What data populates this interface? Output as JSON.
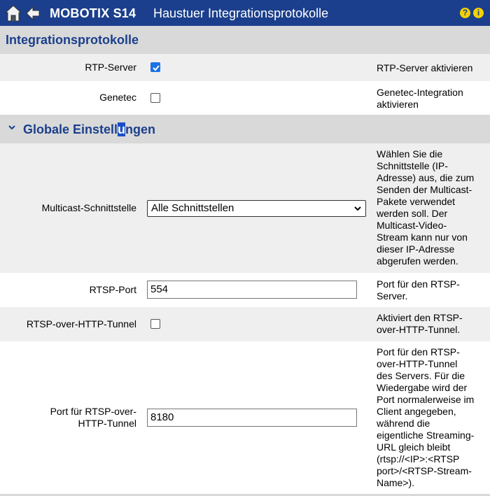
{
  "header": {
    "brand": "MOBOTIX S14",
    "title": "Haustuer Integrationsprotokolle",
    "help_label": "?",
    "info_label": "i"
  },
  "section1": {
    "title": "Integrationsprotokolle"
  },
  "rows": {
    "rtp": {
      "label": "RTP-Server",
      "checked": true,
      "desc": "RTP-Server aktivieren"
    },
    "genetec": {
      "label": "Genetec",
      "checked": false,
      "desc_line1": "Genetec-Integration",
      "desc_line2": "aktivieren"
    }
  },
  "section2": {
    "title_before": "Globale Einstell",
    "title_cursor": "u",
    "title_after": "ngen",
    "chevron": "chevron-down-icon"
  },
  "multicast": {
    "label": "Multicast-Schnittstelle",
    "selected": "Alle Schnittstellen",
    "desc": [
      "Wählen Sie die",
      "Schnittstelle (IP-",
      "Adresse) aus, die zum",
      "Senden der Multicast-",
      "Pakete verwendet",
      "werden soll. Der",
      "Multicast-Video-",
      "Stream kann nur von",
      "dieser IP-Adresse",
      "abgerufen werden."
    ]
  },
  "rtsp_port": {
    "label": "RTSP-Port",
    "value": "554",
    "desc": [
      "Port für den RTSP-",
      "Server."
    ]
  },
  "rtsp_http_tunnel": {
    "label": "RTSP-over-HTTP-Tunnel",
    "checked": false,
    "desc": [
      "Aktiviert den RTSP-",
      "over-HTTP-Tunnel."
    ]
  },
  "tunnel_port": {
    "label_line1": "Port für RTSP-over-",
    "label_line2": "HTTP-Tunnel",
    "value": "8180",
    "desc": [
      "Port für den RTSP-",
      "over-HTTP-Tunnel",
      "des Servers. Für die",
      "Wiedergabe wird der",
      "Port normalerweise im",
      "Client angegeben,",
      "während die",
      "eigentliche Streaming-",
      "URL gleich bleibt",
      "(rtsp://<IP>:<RTSP",
      "port>/<RTSP-Stream-",
      "Name>)."
    ]
  },
  "colors": {
    "titlebar": "#1b3f8c",
    "section": "#d9d9d9",
    "row_gray": "#efefef",
    "checkbox": "#1a73e8"
  }
}
